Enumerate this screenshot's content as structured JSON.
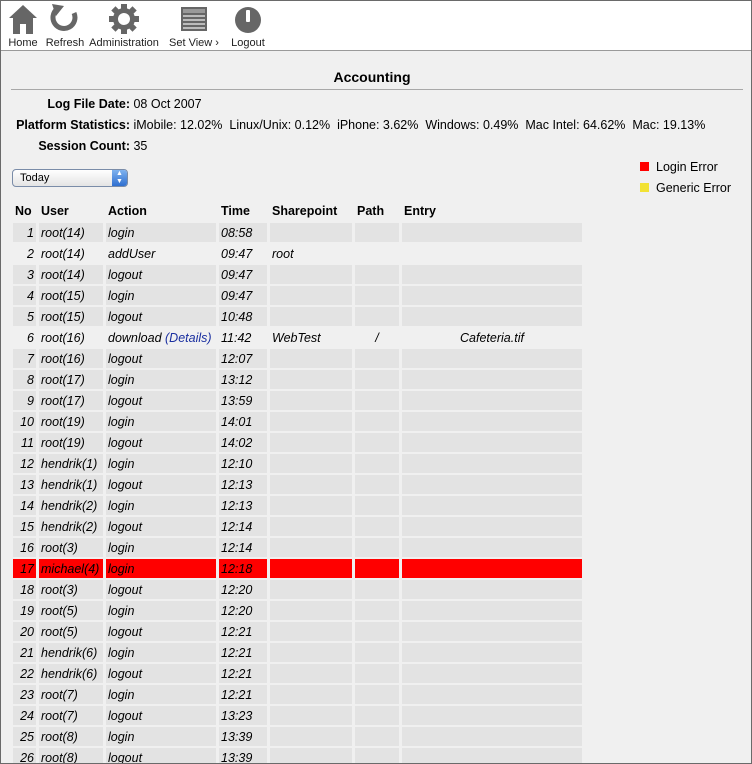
{
  "toolbar": {
    "home": "Home",
    "refresh": "Refresh",
    "administration": "Administration",
    "set_view": "Set View",
    "set_view_arrow": "›",
    "logout": "Logout"
  },
  "page_title": "Accounting",
  "log_file_date": {
    "label": "Log File Date:",
    "value": "08 Oct 2007"
  },
  "platform_statistics": {
    "label": "Platform Statistics:",
    "value": "iMobile: 12.02%  Linux/Unix: 0.12%  iPhone: 3.62%  Windows: 0.49%  Mac Intel: 64.62%  Mac: 19.13%"
  },
  "session_count": {
    "label": "Session Count:",
    "value": "35"
  },
  "period_select": {
    "value": "Today",
    "arrows": "▲▼"
  },
  "legend": {
    "login_error": {
      "label": "Login Error",
      "color": "#ff0000"
    },
    "generic_error": {
      "label": "Generic Error",
      "color": "#f2e234"
    }
  },
  "table": {
    "headers": [
      "No",
      "User",
      "Action",
      "Time",
      "Sharepoint",
      "Path",
      "Entry"
    ],
    "rows": [
      {
        "no": "1",
        "user": "root(14)",
        "action": "login",
        "details": "",
        "time": "08:58",
        "sharepoint": "",
        "path": "",
        "entry": "",
        "style": "shaded"
      },
      {
        "no": "2",
        "user": "root(14)",
        "action": "addUser",
        "details": "",
        "time": "09:47",
        "sharepoint": "root",
        "path": "",
        "entry": "",
        "style": "plain"
      },
      {
        "no": "3",
        "user": "root(14)",
        "action": "logout",
        "details": "",
        "time": "09:47",
        "sharepoint": "",
        "path": "",
        "entry": "",
        "style": "shaded"
      },
      {
        "no": "4",
        "user": "root(15)",
        "action": "login",
        "details": "",
        "time": "09:47",
        "sharepoint": "",
        "path": "",
        "entry": "",
        "style": "shaded"
      },
      {
        "no": "5",
        "user": "root(15)",
        "action": "logout",
        "details": "",
        "time": "10:48",
        "sharepoint": "",
        "path": "",
        "entry": "",
        "style": "shaded"
      },
      {
        "no": "6",
        "user": "root(16)",
        "action": "download",
        "details": "(Details)",
        "time": "11:42",
        "sharepoint": "WebTest",
        "path": "/",
        "entry": "Cafeteria.tif",
        "style": "plain"
      },
      {
        "no": "7",
        "user": "root(16)",
        "action": "logout",
        "details": "",
        "time": "12:07",
        "sharepoint": "",
        "path": "",
        "entry": "",
        "style": "shaded"
      },
      {
        "no": "8",
        "user": "root(17)",
        "action": "login",
        "details": "",
        "time": "13:12",
        "sharepoint": "",
        "path": "",
        "entry": "",
        "style": "shaded"
      },
      {
        "no": "9",
        "user": "root(17)",
        "action": "logout",
        "details": "",
        "time": "13:59",
        "sharepoint": "",
        "path": "",
        "entry": "",
        "style": "shaded"
      },
      {
        "no": "10",
        "user": "root(19)",
        "action": "login",
        "details": "",
        "time": "14:01",
        "sharepoint": "",
        "path": "",
        "entry": "",
        "style": "shaded"
      },
      {
        "no": "11",
        "user": "root(19)",
        "action": "logout",
        "details": "",
        "time": "14:02",
        "sharepoint": "",
        "path": "",
        "entry": "",
        "style": "shaded"
      },
      {
        "no": "12",
        "user": "hendrik(1)",
        "action": "login",
        "details": "",
        "time": "12:10",
        "sharepoint": "",
        "path": "",
        "entry": "",
        "style": "shaded"
      },
      {
        "no": "13",
        "user": "hendrik(1)",
        "action": "logout",
        "details": "",
        "time": "12:13",
        "sharepoint": "",
        "path": "",
        "entry": "",
        "style": "shaded"
      },
      {
        "no": "14",
        "user": "hendrik(2)",
        "action": "login",
        "details": "",
        "time": "12:13",
        "sharepoint": "",
        "path": "",
        "entry": "",
        "style": "shaded"
      },
      {
        "no": "15",
        "user": "hendrik(2)",
        "action": "logout",
        "details": "",
        "time": "12:14",
        "sharepoint": "",
        "path": "",
        "entry": "",
        "style": "shaded"
      },
      {
        "no": "16",
        "user": "root(3)",
        "action": "login",
        "details": "",
        "time": "12:14",
        "sharepoint": "",
        "path": "",
        "entry": "",
        "style": "shaded"
      },
      {
        "no": "17",
        "user": "michael(4)",
        "action": "login",
        "details": "",
        "time": "12:18",
        "sharepoint": "",
        "path": "",
        "entry": "",
        "style": "err"
      },
      {
        "no": "18",
        "user": "root(3)",
        "action": "logout",
        "details": "",
        "time": "12:20",
        "sharepoint": "",
        "path": "",
        "entry": "",
        "style": "shaded"
      },
      {
        "no": "19",
        "user": "root(5)",
        "action": "login",
        "details": "",
        "time": "12:20",
        "sharepoint": "",
        "path": "",
        "entry": "",
        "style": "shaded"
      },
      {
        "no": "20",
        "user": "root(5)",
        "action": "logout",
        "details": "",
        "time": "12:21",
        "sharepoint": "",
        "path": "",
        "entry": "",
        "style": "shaded"
      },
      {
        "no": "21",
        "user": "hendrik(6)",
        "action": "login",
        "details": "",
        "time": "12:21",
        "sharepoint": "",
        "path": "",
        "entry": "",
        "style": "shaded"
      },
      {
        "no": "22",
        "user": "hendrik(6)",
        "action": "logout",
        "details": "",
        "time": "12:21",
        "sharepoint": "",
        "path": "",
        "entry": "",
        "style": "shaded"
      },
      {
        "no": "23",
        "user": "root(7)",
        "action": "login",
        "details": "",
        "time": "12:21",
        "sharepoint": "",
        "path": "",
        "entry": "",
        "style": "shaded"
      },
      {
        "no": "24",
        "user": "root(7)",
        "action": "logout",
        "details": "",
        "time": "13:23",
        "sharepoint": "",
        "path": "",
        "entry": "",
        "style": "shaded"
      },
      {
        "no": "25",
        "user": "root(8)",
        "action": "login",
        "details": "",
        "time": "13:39",
        "sharepoint": "",
        "path": "",
        "entry": "",
        "style": "shaded"
      },
      {
        "no": "26",
        "user": "root(8)",
        "action": "logout",
        "details": "",
        "time": "13:39",
        "sharepoint": "",
        "path": "",
        "entry": "",
        "style": "shaded"
      }
    ]
  },
  "icons": [
    "home-icon",
    "refresh-icon",
    "gear-icon",
    "set-view-icon",
    "power-icon"
  ]
}
